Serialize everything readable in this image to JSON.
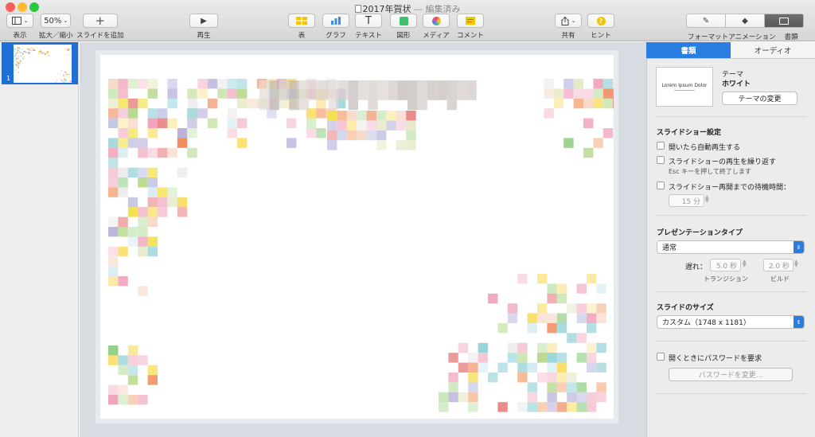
{
  "window": {
    "title": "2017年賀状",
    "subtitle": "— 編集済み"
  },
  "toolbar": {
    "view_label": "表示",
    "zoom_value": "50%",
    "zoom_label": "拡大／縮小",
    "add_slide_label": "スライドを追加",
    "play_label": "再生",
    "table_label": "表",
    "chart_label": "グラフ",
    "text_label": "テキスト",
    "shape_label": "図形",
    "media_label": "メディア",
    "comment_label": "コメント",
    "share_label": "共有",
    "tips_label": "ヒント",
    "format_label": "フォーマット",
    "animate_label": "アニメーション",
    "document_label": "書類"
  },
  "navigator": {
    "slide_number": "1"
  },
  "inspector": {
    "tabs": [
      "書類",
      "オーディオ"
    ],
    "theme": {
      "label": "テーマ",
      "name": "ホワイト",
      "preview_text": "Lorem Ipsum Dolor",
      "change_button": "テーマの変更"
    },
    "slideshow": {
      "header": "スライドショー設定",
      "autoplay": "開いたら自動再生する",
      "loop": "スライドショーの再生を繰り返す",
      "loop_hint": "Esc キーを押して終了します",
      "idle": "スライドショー再開までの待機時間：",
      "idle_value": "15 分"
    },
    "presentation": {
      "header": "プレゼンテーションタイプ",
      "type": "通常",
      "delay_label": "遅れ：",
      "transition_value": "5.0 秒",
      "build_value": "2.0 秒",
      "transition_label": "トランジション",
      "build_label": "ビルド"
    },
    "size": {
      "header": "スライドのサイズ",
      "value": "カスタム（1748 x 1181）"
    },
    "password": {
      "require": "開くときにパスワードを要求",
      "change_button": "パスワードを変更..."
    }
  },
  "colors": {
    "accent": "#2a7de1",
    "close": "#fc5f57",
    "minimize": "#fdbc2e",
    "zoom": "#2ac840"
  }
}
